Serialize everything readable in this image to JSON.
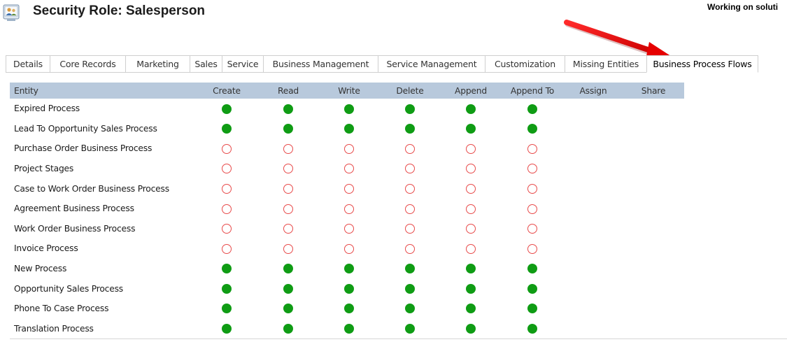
{
  "header": {
    "title": "Security Role: Salesperson",
    "status": "Working on soluti"
  },
  "colors": {
    "header_band": "#b8c9dc",
    "full_access": "#0f9c14",
    "no_access": "#e84a4a",
    "callout_arrow": "#e60000"
  },
  "callout": {
    "icon": "red-arrow-icon",
    "points_to": "Business Process Flows"
  },
  "tabs": [
    {
      "label": "Details",
      "selected": false
    },
    {
      "label": "Core Records",
      "selected": false
    },
    {
      "label": "Marketing",
      "selected": false
    },
    {
      "label": "Sales",
      "selected": false
    },
    {
      "label": "Service",
      "selected": false
    },
    {
      "label": "Business Management",
      "selected": false
    },
    {
      "label": "Service Management",
      "selected": false
    },
    {
      "label": "Customization",
      "selected": false
    },
    {
      "label": "Missing Entities",
      "selected": false
    },
    {
      "label": "Business Process Flows",
      "selected": true
    }
  ],
  "table": {
    "columns": [
      "Entity",
      "Create",
      "Read",
      "Write",
      "Delete",
      "Append",
      "Append To",
      "Assign",
      "Share"
    ],
    "rows": [
      {
        "entity": "Expired Process",
        "access": [
          "full",
          "full",
          "full",
          "full",
          "full",
          "full",
          null,
          null
        ]
      },
      {
        "entity": "Lead To Opportunity Sales Process",
        "access": [
          "full",
          "full",
          "full",
          "full",
          "full",
          "full",
          null,
          null
        ]
      },
      {
        "entity": "Purchase Order Business Process",
        "access": [
          "none",
          "none",
          "none",
          "none",
          "none",
          "none",
          null,
          null
        ]
      },
      {
        "entity": "Project Stages",
        "access": [
          "none",
          "none",
          "none",
          "none",
          "none",
          "none",
          null,
          null
        ]
      },
      {
        "entity": "Case to Work Order Business Process",
        "access": [
          "none",
          "none",
          "none",
          "none",
          "none",
          "none",
          null,
          null
        ]
      },
      {
        "entity": "Agreement Business Process",
        "access": [
          "none",
          "none",
          "none",
          "none",
          "none",
          "none",
          null,
          null
        ]
      },
      {
        "entity": "Work Order Business Process",
        "access": [
          "none",
          "none",
          "none",
          "none",
          "none",
          "none",
          null,
          null
        ]
      },
      {
        "entity": "Invoice Process",
        "access": [
          "none",
          "none",
          "none",
          "none",
          "none",
          "none",
          null,
          null
        ]
      },
      {
        "entity": "New Process",
        "access": [
          "full",
          "full",
          "full",
          "full",
          "full",
          "full",
          null,
          null
        ]
      },
      {
        "entity": "Opportunity Sales Process",
        "access": [
          "full",
          "full",
          "full",
          "full",
          "full",
          "full",
          null,
          null
        ]
      },
      {
        "entity": "Phone To Case Process",
        "access": [
          "full",
          "full",
          "full",
          "full",
          "full",
          "full",
          null,
          null
        ]
      },
      {
        "entity": "Translation Process",
        "access": [
          "full",
          "full",
          "full",
          "full",
          "full",
          "full",
          null,
          null
        ]
      }
    ]
  }
}
